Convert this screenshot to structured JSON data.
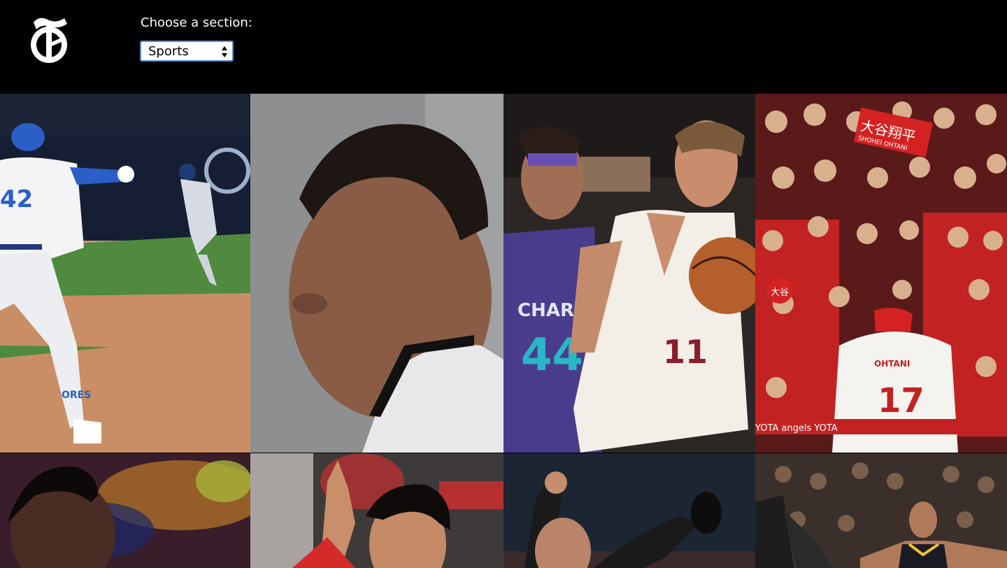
{
  "header": {
    "logo_icon": "nyt-t-logo-icon",
    "section_label": "Choose a section:",
    "section_select": {
      "value": "Sports"
    }
  },
  "grid": {
    "tiles": [
      {
        "jersey_number": "42",
        "jersey_name": "ORES"
      },
      {},
      {
        "jersey_text": "CHARLOTTE",
        "jersey_number": "44",
        "jersey_number_2": "11"
      },
      {
        "sign_text": "大谷翔平",
        "sign_subtext": "SHOHEI OHTANI",
        "fan_sign": "大谷",
        "jersey_name": "OHTANI",
        "jersey_number": "17",
        "banner": "YOTA  angels  YOTA"
      },
      {},
      {},
      {},
      {}
    ]
  }
}
